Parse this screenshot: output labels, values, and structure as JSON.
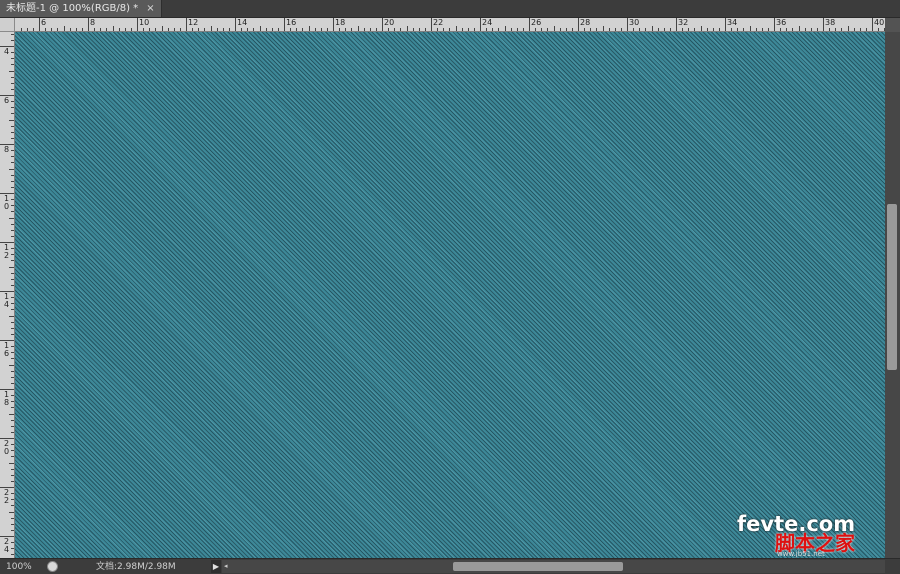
{
  "tab": {
    "title": "未标题-1 @ 100%(RGB/8) *",
    "close_glyph": "×"
  },
  "ruler": {
    "horizontal_labels": [
      "6",
      "8",
      "10",
      "12",
      "14",
      "16",
      "18",
      "20",
      "22",
      "24",
      "26",
      "28",
      "30",
      "32",
      "34",
      "36",
      "38",
      "40"
    ],
    "vertical_labels": [
      "4",
      "6",
      "8",
      "10",
      "12",
      "14",
      "16",
      "18",
      "20",
      "22",
      "24"
    ]
  },
  "canvas": {
    "fill_color": "#3d8898",
    "stripe_color": "#0f2d37",
    "pattern": "denim-diagonal"
  },
  "status": {
    "zoom": "100%",
    "doc_info": "文档:2.98M/2.98M",
    "arrow_glyph": "▶",
    "scroll_left_glyph": "◂"
  },
  "scroll": {
    "vertical_position": 0.5,
    "horizontal_position": 0.5
  },
  "watermark": {
    "top": "fevte.com",
    "bottom": "脚本之家",
    "url": "www.jb51.net",
    "colors": {
      "white": "#ffffff",
      "red": "#dd1111"
    }
  }
}
